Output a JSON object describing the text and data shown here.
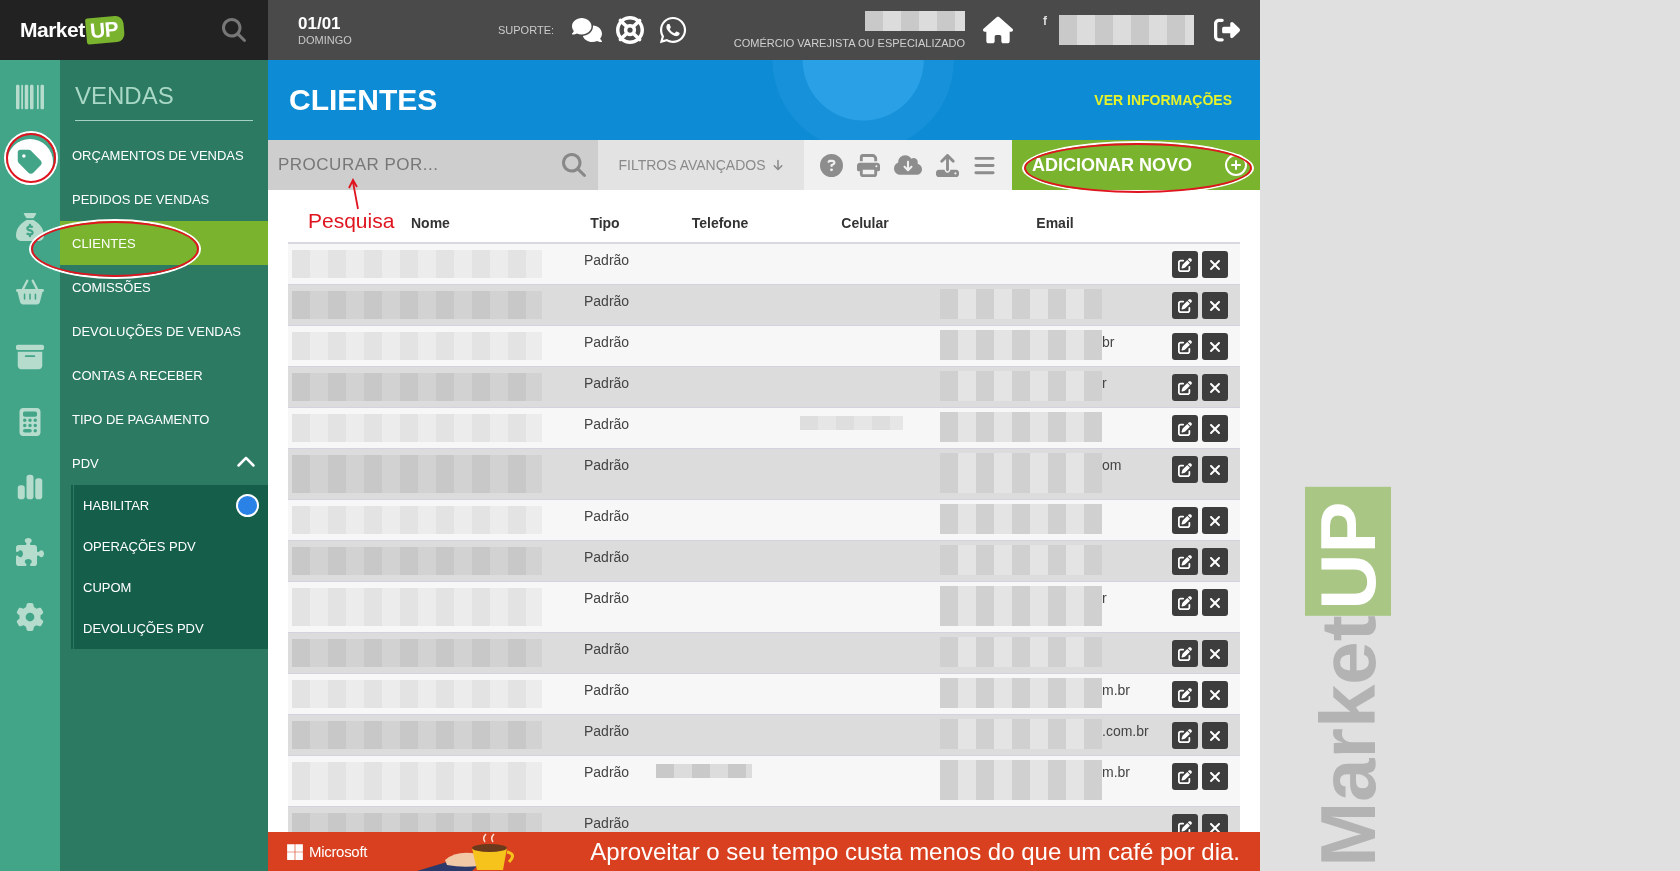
{
  "topbar": {
    "logo": {
      "word": "Market",
      "tag": "UP"
    },
    "date": "01/01",
    "weekday": "DOMINGO",
    "support_label": "SUPORTE:",
    "segment": "COMÉRCIO VAREJISTA OU ESPECIALIZADO",
    "social": "f"
  },
  "rail": [
    {
      "kind": "barcode",
      "selected": false
    },
    {
      "kind": "tag",
      "selected": true
    },
    {
      "kind": "money",
      "selected": false
    },
    {
      "kind": "basket",
      "selected": false
    },
    {
      "kind": "archive",
      "selected": false
    },
    {
      "kind": "calculator",
      "selected": false
    },
    {
      "kind": "chart",
      "selected": false
    },
    {
      "kind": "puzzle",
      "selected": false
    },
    {
      "kind": "gear",
      "selected": false
    }
  ],
  "menu": {
    "title": "VENDAS",
    "items": [
      {
        "label": "ORÇAMENTOS DE VENDAS",
        "selected": false
      },
      {
        "label": "PEDIDOS DE VENDAS",
        "selected": false
      },
      {
        "label": "CLIENTES",
        "selected": true
      },
      {
        "label": "COMISSÕES",
        "selected": false
      },
      {
        "label": "DEVOLUÇÕES DE VENDAS",
        "selected": false
      },
      {
        "label": "CONTAS A RECEBER",
        "selected": false
      },
      {
        "label": "TIPO DE PAGAMENTO",
        "selected": false
      },
      {
        "label": "PDV",
        "selected": false,
        "expanded": true,
        "children": [
          {
            "label": "HABILITAR",
            "on": true
          },
          {
            "label": "OPERAÇÕES PDV"
          },
          {
            "label": "CUPOM"
          },
          {
            "label": "DEVOLUÇÕES PDV"
          }
        ]
      }
    ]
  },
  "page": {
    "title": "CLIENTES",
    "info_link": "VER INFORMAÇÕES"
  },
  "toolbar": {
    "search": {
      "placeholder": "PROCURAR POR..."
    },
    "filters": "FILTROS AVANÇADOS",
    "add_button": "ADICIONAR NOVO"
  },
  "annotation": {
    "label": "Pesquisa"
  },
  "table": {
    "columns": [
      "Nome",
      "Tipo",
      "Telefone",
      "Celular",
      "Email"
    ],
    "rows": [
      {
        "tipo": "Padrão",
        "wrapped": false,
        "phone_redacted": false,
        "mobile_redacted": false,
        "email_redacted": false
      },
      {
        "tipo": "Padrão",
        "wrapped": false,
        "phone_redacted": false,
        "mobile_redacted": false,
        "email_redacted": true
      },
      {
        "tipo": "Padrão",
        "wrapped": false,
        "phone_redacted": false,
        "mobile_redacted": false,
        "email_redacted": true,
        "email_tail": "br"
      },
      {
        "tipo": "Padrão",
        "wrapped": false,
        "phone_redacted": false,
        "mobile_redacted": false,
        "email_redacted": true,
        "email_tail": "r"
      },
      {
        "tipo": "Padrão",
        "wrapped": false,
        "phone_redacted": false,
        "mobile_redacted": true,
        "email_redacted": true
      },
      {
        "tipo": "Padrão",
        "wrapped": true,
        "phone_redacted": false,
        "mobile_redacted": false,
        "email_redacted": true,
        "email_tail": "om"
      },
      {
        "tipo": "Padrão",
        "wrapped": false,
        "phone_redacted": false,
        "mobile_redacted": false,
        "email_redacted": true
      },
      {
        "tipo": "Padrão",
        "wrapped": false,
        "phone_redacted": false,
        "mobile_redacted": false,
        "email_redacted": true
      },
      {
        "tipo": "Padrão",
        "wrapped": true,
        "phone_redacted": false,
        "mobile_redacted": false,
        "email_redacted": true,
        "email_tail": "r"
      },
      {
        "tipo": "Padrão",
        "wrapped": false,
        "phone_redacted": false,
        "mobile_redacted": false,
        "email_redacted": true
      },
      {
        "tipo": "Padrão",
        "wrapped": false,
        "phone_redacted": false,
        "mobile_redacted": false,
        "email_redacted": true,
        "email_tail": "m.br"
      },
      {
        "tipo": "Padrão",
        "wrapped": false,
        "phone_redacted": false,
        "mobile_redacted": false,
        "email_redacted": true,
        "email_tail": ".com.br"
      },
      {
        "tipo": "Padrão",
        "wrapped": true,
        "phone_redacted": true,
        "mobile_redacted": false,
        "email_redacted": true,
        "email_tail": "m.br"
      },
      {
        "tipo": "Padrão",
        "wrapped": false,
        "phone_redacted": false,
        "mobile_redacted": false,
        "email_redacted": false
      }
    ]
  },
  "ad_banner": {
    "brand": "Microsoft",
    "message": "Aproveitar o seu tempo custa menos do que um café por dia."
  },
  "background_logo": {
    "word": "Market",
    "tag": "UP"
  }
}
